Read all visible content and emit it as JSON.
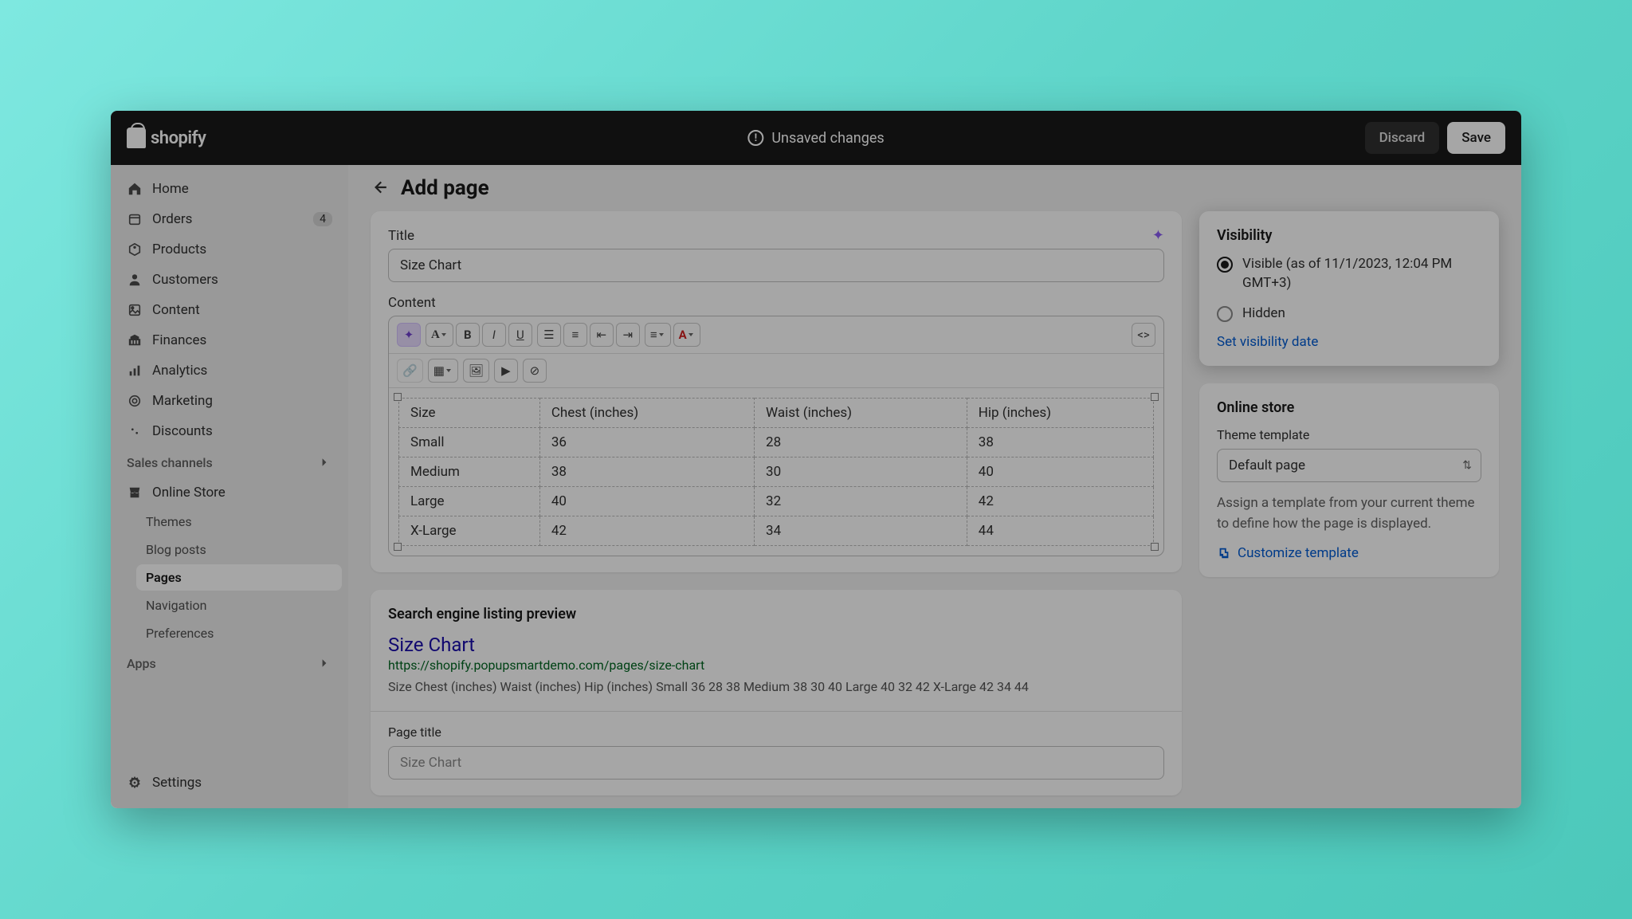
{
  "topbar": {
    "unsaved": "Unsaved changes",
    "discard": "Discard",
    "save": "Save"
  },
  "page_title": "Add page",
  "sidebar": {
    "items": [
      {
        "label": "Home"
      },
      {
        "label": "Orders",
        "badge": "4"
      },
      {
        "label": "Products"
      },
      {
        "label": "Customers"
      },
      {
        "label": "Content"
      },
      {
        "label": "Finances"
      },
      {
        "label": "Analytics"
      },
      {
        "label": "Marketing"
      },
      {
        "label": "Discounts"
      }
    ],
    "sales_channels": "Sales channels",
    "online_store": "Online Store",
    "sub": [
      {
        "label": "Themes"
      },
      {
        "label": "Blog posts"
      },
      {
        "label": "Pages"
      },
      {
        "label": "Navigation"
      },
      {
        "label": "Preferences"
      }
    ],
    "apps": "Apps",
    "settings": "Settings"
  },
  "editor_card": {
    "title_label": "Title",
    "title_value": "Size Chart",
    "content_label": "Content",
    "table": {
      "headers": [
        "Size",
        "Chest (inches)",
        "Waist (inches)",
        "Hip (inches)"
      ],
      "rows": [
        [
          "Small",
          "36",
          "28",
          "38"
        ],
        [
          "Medium",
          "38",
          "30",
          "40"
        ],
        [
          "Large",
          "40",
          "32",
          "42"
        ],
        [
          "X-Large",
          "42",
          "34",
          "44"
        ]
      ]
    }
  },
  "seo": {
    "heading": "Search engine listing preview",
    "title": "Size Chart",
    "url": "https://shopify.popupsmartdemo.com/pages/size-chart",
    "desc": "Size Chest (inches) Waist (inches) Hip (inches) Small 36 28 38 Medium 38 30 40 Large 40 32 42 X-Large 42 34 44",
    "page_title_label": "Page title",
    "page_title_placeholder": "Size Chart"
  },
  "visibility": {
    "heading": "Visibility",
    "visible": "Visible (as of 11/1/2023, 12:04 PM GMT+3)",
    "hidden": "Hidden",
    "set_date": "Set visibility date"
  },
  "online_store_card": {
    "heading": "Online store",
    "theme_label": "Theme template",
    "theme_value": "Default page",
    "help": "Assign a template from your current theme to define how the page is displayed.",
    "customize": "Customize template"
  }
}
